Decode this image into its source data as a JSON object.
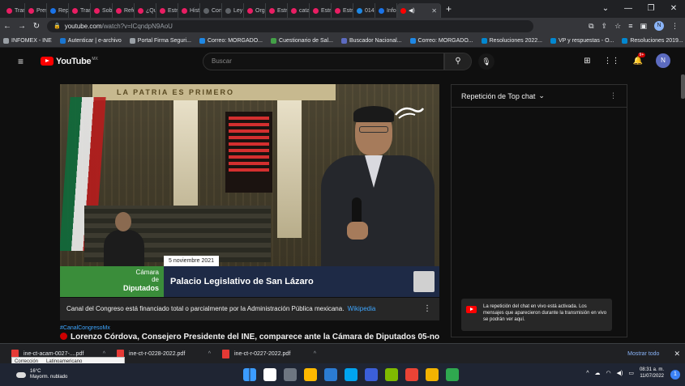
{
  "browser": {
    "tabs": [
      {
        "label": "Tran:",
        "color": "#e91e63"
      },
      {
        "label": "Pres:",
        "color": "#e91e63"
      },
      {
        "label": "Repc",
        "color": "#1a73e8"
      },
      {
        "label": "Tran:",
        "color": "#e91e63"
      },
      {
        "label": "Sob:",
        "color": "#e91e63"
      },
      {
        "label": "Refo",
        "color": "#e91e63"
      },
      {
        "label": "¿Qu:",
        "color": "#e91e63"
      },
      {
        "label": "Estru",
        "color": "#e91e63"
      },
      {
        "label": "Hist:",
        "color": "#e91e63"
      },
      {
        "label": "Con:",
        "color": "#5f6368"
      },
      {
        "label": "Ley (",
        "color": "#5f6368"
      },
      {
        "label": "Orgu",
        "color": "#e91e63"
      },
      {
        "label": "Estru",
        "color": "#e91e63"
      },
      {
        "label": "catal",
        "color": "#e91e63"
      },
      {
        "label": "Estru",
        "color": "#e91e63"
      },
      {
        "label": "Estru",
        "color": "#e91e63"
      },
      {
        "label": "014.",
        "color": "#1e88e5"
      },
      {
        "label": "Info:",
        "color": "#1a73e8"
      }
    ],
    "url_host": "youtube.com",
    "url_path": "/watch?v=lCqndpN9AoU",
    "profile_initial": "N",
    "bookmarks": [
      {
        "label": "INFOMEX - INE",
        "color": "#9aa0a6"
      },
      {
        "label": "Autenticar | e-archivo",
        "color": "#1976d2"
      },
      {
        "label": "Portal Firma Seguri...",
        "color": "#9aa0a6"
      },
      {
        "label": "Correo: MORGADO...",
        "color": "#1e88e5"
      },
      {
        "label": "Cuestionario de Sal...",
        "color": "#43a047"
      },
      {
        "label": "Buscador Nacional...",
        "color": "#5c6bc0"
      },
      {
        "label": "Correo: MORGADO...",
        "color": "#1e88e5"
      },
      {
        "label": "Resoluciones 2022...",
        "color": "#0288d1"
      },
      {
        "label": "VP y respuestas - O...",
        "color": "#0288d1"
      },
      {
        "label": "Resoluciones 2019...",
        "color": "#0288d1"
      }
    ]
  },
  "youtube": {
    "logo_text": "YouTube",
    "logo_country": "MX",
    "search_placeholder": "Buscar",
    "notif_badge": "9+",
    "avatar_initial": "N"
  },
  "video": {
    "inscription": "LA PATRIA ES PRIMERO",
    "date_chip": "5 noviembre 2021",
    "lower_green_line1": "Cámara",
    "lower_green_line2": "de",
    "lower_green_line3": "Diputados",
    "lower_navy_text": "Palacio Legislativo de San Lázaro"
  },
  "banner": {
    "text": "Canal del Congreso está financiado total o parcialmente por la Administración Pública mexicana.",
    "link": "Wikipedia"
  },
  "hashtag": "#CanalCongresoMx",
  "video_title": "Lorenzo Córdova, Consejero Presidente del INE, comparece ante la Cámara de Diputados 05-nov-",
  "chat": {
    "header": "Repetición de Top chat",
    "note": "La repetición del chat en vivo está activada. Los mensajes que aparecieron durante la transmisión en vivo se podrán ver aquí."
  },
  "downloads": {
    "items": [
      "ine-ct-acam-0027-....pdf",
      "ine-ct-r-0228-2022.pdf",
      "ine-ct-r-0227-2022.pdf"
    ],
    "show_all": "Mostrar todo",
    "tooltip_items": [
      "Corrección",
      "Latinoamericano"
    ]
  },
  "taskbar": {
    "temp": "16°C",
    "weather": "Mayorm. nublado",
    "time": "08:31 a. m.",
    "date": "11/07/2022",
    "notif_count": "1",
    "apps": [
      "#0078d4",
      "#ffffff",
      "#6e7681",
      "#ffb900",
      "#2b7cd3",
      "#00a4ef",
      "#3b5fd9",
      "#7fba00",
      "#ea4335",
      "#f2b300",
      "#2fa84f"
    ]
  }
}
